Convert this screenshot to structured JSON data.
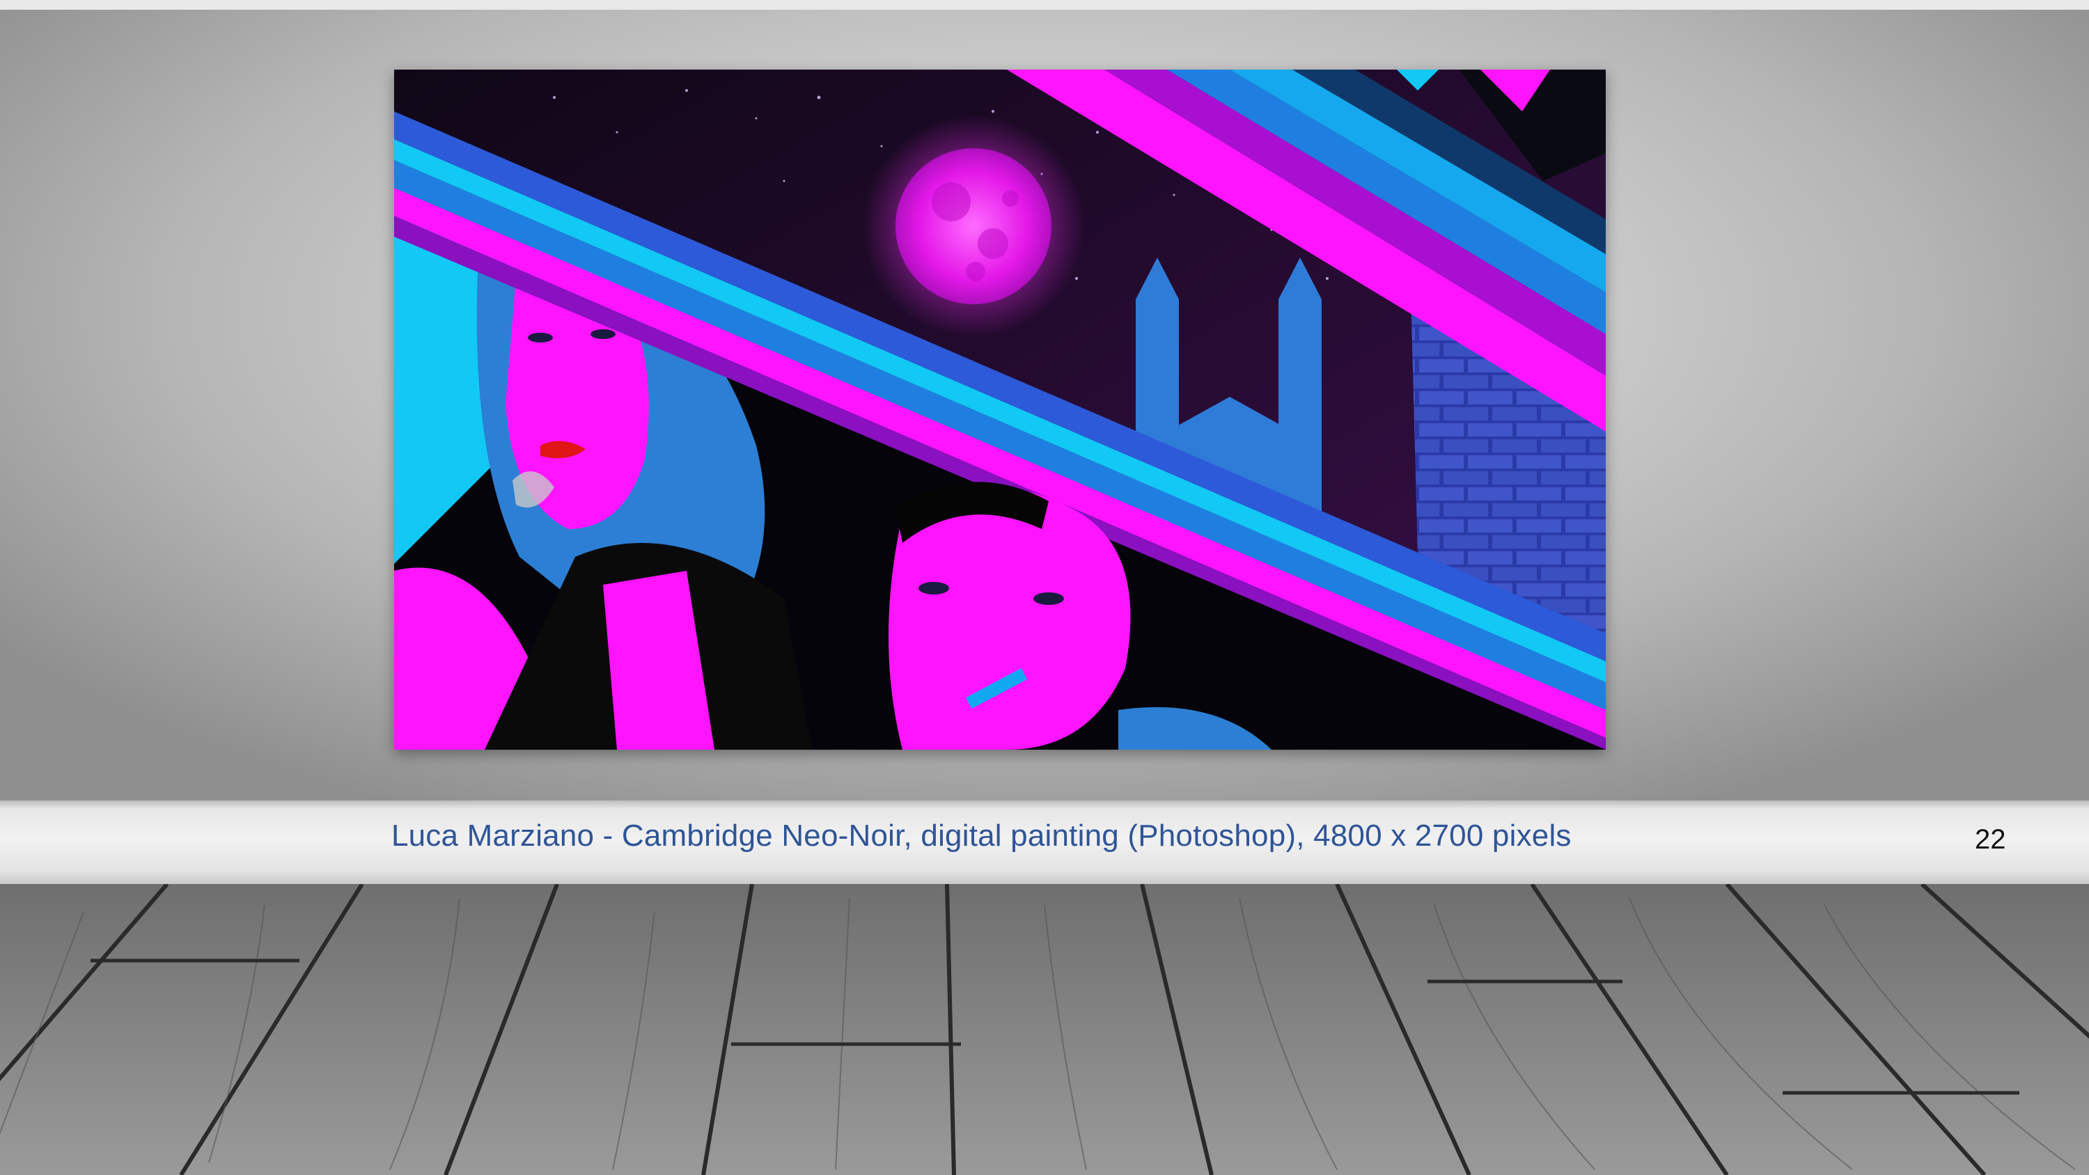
{
  "slide": {
    "caption": "Luca Marziano - Cambridge Neo-Noir, digital painting (Photoshop), 4800 x 2700 pixels",
    "page_number": "22"
  },
  "colors": {
    "caption_text": "#2f5597",
    "page_number_text": "#111111",
    "magenta": "#ff14ff",
    "cyan": "#12c8f5",
    "blue": "#1f7fe0",
    "night": "#140a1c"
  },
  "icons": {
    "artwork": "neon-portrait-artwork",
    "background": "gallery-wall-and-wooden-floor"
  }
}
